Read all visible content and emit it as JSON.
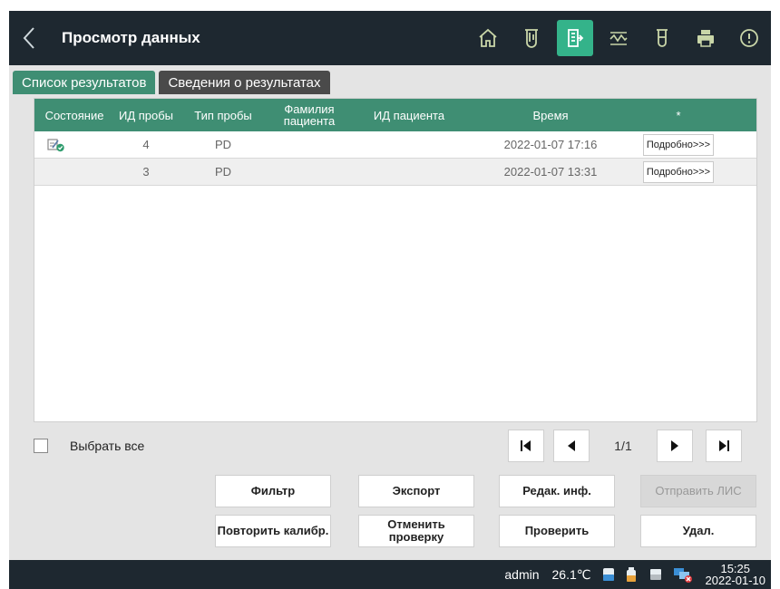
{
  "header": {
    "title": "Просмотр данных",
    "icons": [
      "home-icon",
      "test-tube-icon",
      "data-review-icon",
      "calibration-curve-icon",
      "sample-tube-icon",
      "printer-icon",
      "alert-icon"
    ],
    "active_icon": "data-review-icon"
  },
  "tabs": [
    {
      "label": "Список результатов",
      "active": true
    },
    {
      "label": "Сведения о результатах",
      "active": false
    }
  ],
  "table": {
    "headers": {
      "status": "Состояние",
      "sample_id": "ИД пробы",
      "sample_type": "Тип пробы",
      "patient_surname": "Фамилия пациента",
      "patient_id": "ИД пациента",
      "time": "Время",
      "star": "*"
    },
    "rows": [
      {
        "status_icon": "verified-edit-icon",
        "sample_id": "4",
        "sample_type": "PD",
        "patient_surname": "",
        "patient_id": "",
        "time": "2022-01-07 17:16",
        "detail": "Подробно>>>"
      },
      {
        "status_icon": "",
        "sample_id": "3",
        "sample_type": "PD",
        "patient_surname": "",
        "patient_id": "",
        "time": "2022-01-07 13:31",
        "detail": "Подробно>>>"
      }
    ]
  },
  "select_all": {
    "label": "Выбрать все",
    "checked": false
  },
  "pager": {
    "info": "1/1"
  },
  "actions": {
    "filter": "Фильтр",
    "export": "Экспорт",
    "edit_info": "Редак. инф.",
    "send_lis": "Отправить ЛИС",
    "recalibrate": "Повторить калибр.",
    "cancel_check": "Отменить проверку",
    "check": "Проверить",
    "delete": "Удал."
  },
  "statusbar": {
    "user": "admin",
    "temperature": "26.1℃",
    "time": "15:25",
    "date": "2022-01-10"
  },
  "colors": {
    "accent": "#3f8e73",
    "header_bg": "#1e2830",
    "active_icon_bg": "#34b38a"
  }
}
